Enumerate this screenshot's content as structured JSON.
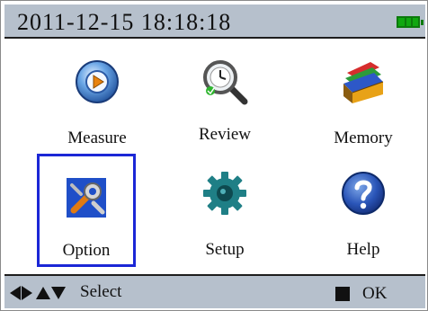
{
  "status_bar": {
    "datetime": "2011-12-15 18:18:18",
    "battery_icon": "battery-full-icon",
    "battery_color": "#10a810"
  },
  "menu": {
    "items": [
      {
        "label": "Measure",
        "icon": "measure-disc-icon",
        "selected": false
      },
      {
        "label": "Review",
        "icon": "magnifier-clock-icon",
        "selected": false
      },
      {
        "label": "Memory",
        "icon": "memory-folders-icon",
        "selected": false
      },
      {
        "label": "Option",
        "icon": "wrench-tools-icon",
        "selected": true
      },
      {
        "label": "Setup",
        "icon": "gear-icon",
        "selected": false
      },
      {
        "label": "Help",
        "icon": "question-icon",
        "selected": false
      }
    ],
    "selection_color": "#1b27d6"
  },
  "footer": {
    "nav_icon": "arrow-keys-icon",
    "select_label": "Select",
    "ok_icon": "square-key-icon",
    "ok_label": "OK"
  },
  "colors": {
    "bar_background": "#b6c0cc",
    "background": "#ffffff"
  }
}
